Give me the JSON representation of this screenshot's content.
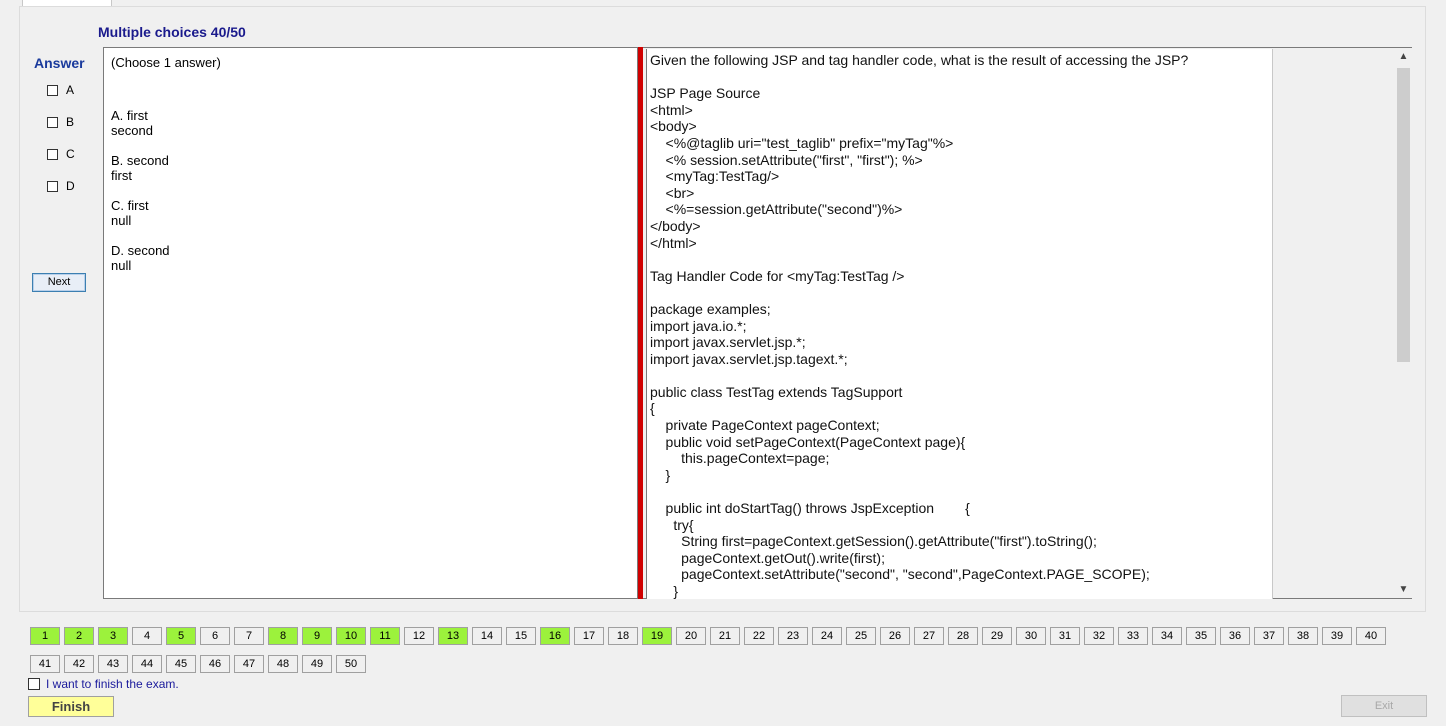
{
  "header": {
    "title": "Multiple choices 40/50"
  },
  "answer": {
    "title": "Answer",
    "options": [
      "A",
      "B",
      "C",
      "D"
    ],
    "next_label": "Next"
  },
  "choices": {
    "hint": "(Choose 1 answer)",
    "items": [
      [
        "A. first",
        "second"
      ],
      [
        "B. second",
        "first"
      ],
      [
        "C. first",
        "null"
      ],
      [
        "D. second",
        "null"
      ]
    ]
  },
  "question": {
    "lines": [
      "Given the following JSP and tag handler code, what is the result of accessing the JSP?",
      "",
      "JSP Page Source",
      "<html>",
      "<body>",
      "    <%@taglib uri=\"test_taglib\" prefix=\"myTag\"%>",
      "    <% session.setAttribute(\"first\", \"first\"); %>",
      "    <myTag:TestTag/>",
      "    <br>",
      "    <%=session.getAttribute(\"second\")%>",
      "</body>",
      "</html>",
      "",
      "Tag Handler Code for <myTag:TestTag />",
      "",
      "package examples;",
      "import java.io.*;",
      "import javax.servlet.jsp.*;",
      "import javax.servlet.jsp.tagext.*;",
      "",
      "public class TestTag extends TagSupport",
      "{",
      "    private PageContext pageContext;",
      "    public void setPageContext(PageContext page){",
      "        this.pageContext=page;",
      "    }",
      "",
      "    public int doStartTag() throws JspException        {",
      "      try{",
      "        String first=pageContext.getSession().getAttribute(\"first\").toString();",
      "        pageContext.getOut().write(first);",
      "        pageContext.setAttribute(\"second\", \"second\",PageContext.PAGE_SCOPE);",
      "      }"
    ]
  },
  "navigation": {
    "answered": [
      1,
      2,
      3,
      5,
      8,
      9,
      10,
      11,
      13,
      16,
      19
    ],
    "total": 50,
    "per_row": 40
  },
  "footer": {
    "finish_checkbox_label": "I want to finish the exam.",
    "finish_label": "Finish",
    "exit_label": "Exit"
  }
}
